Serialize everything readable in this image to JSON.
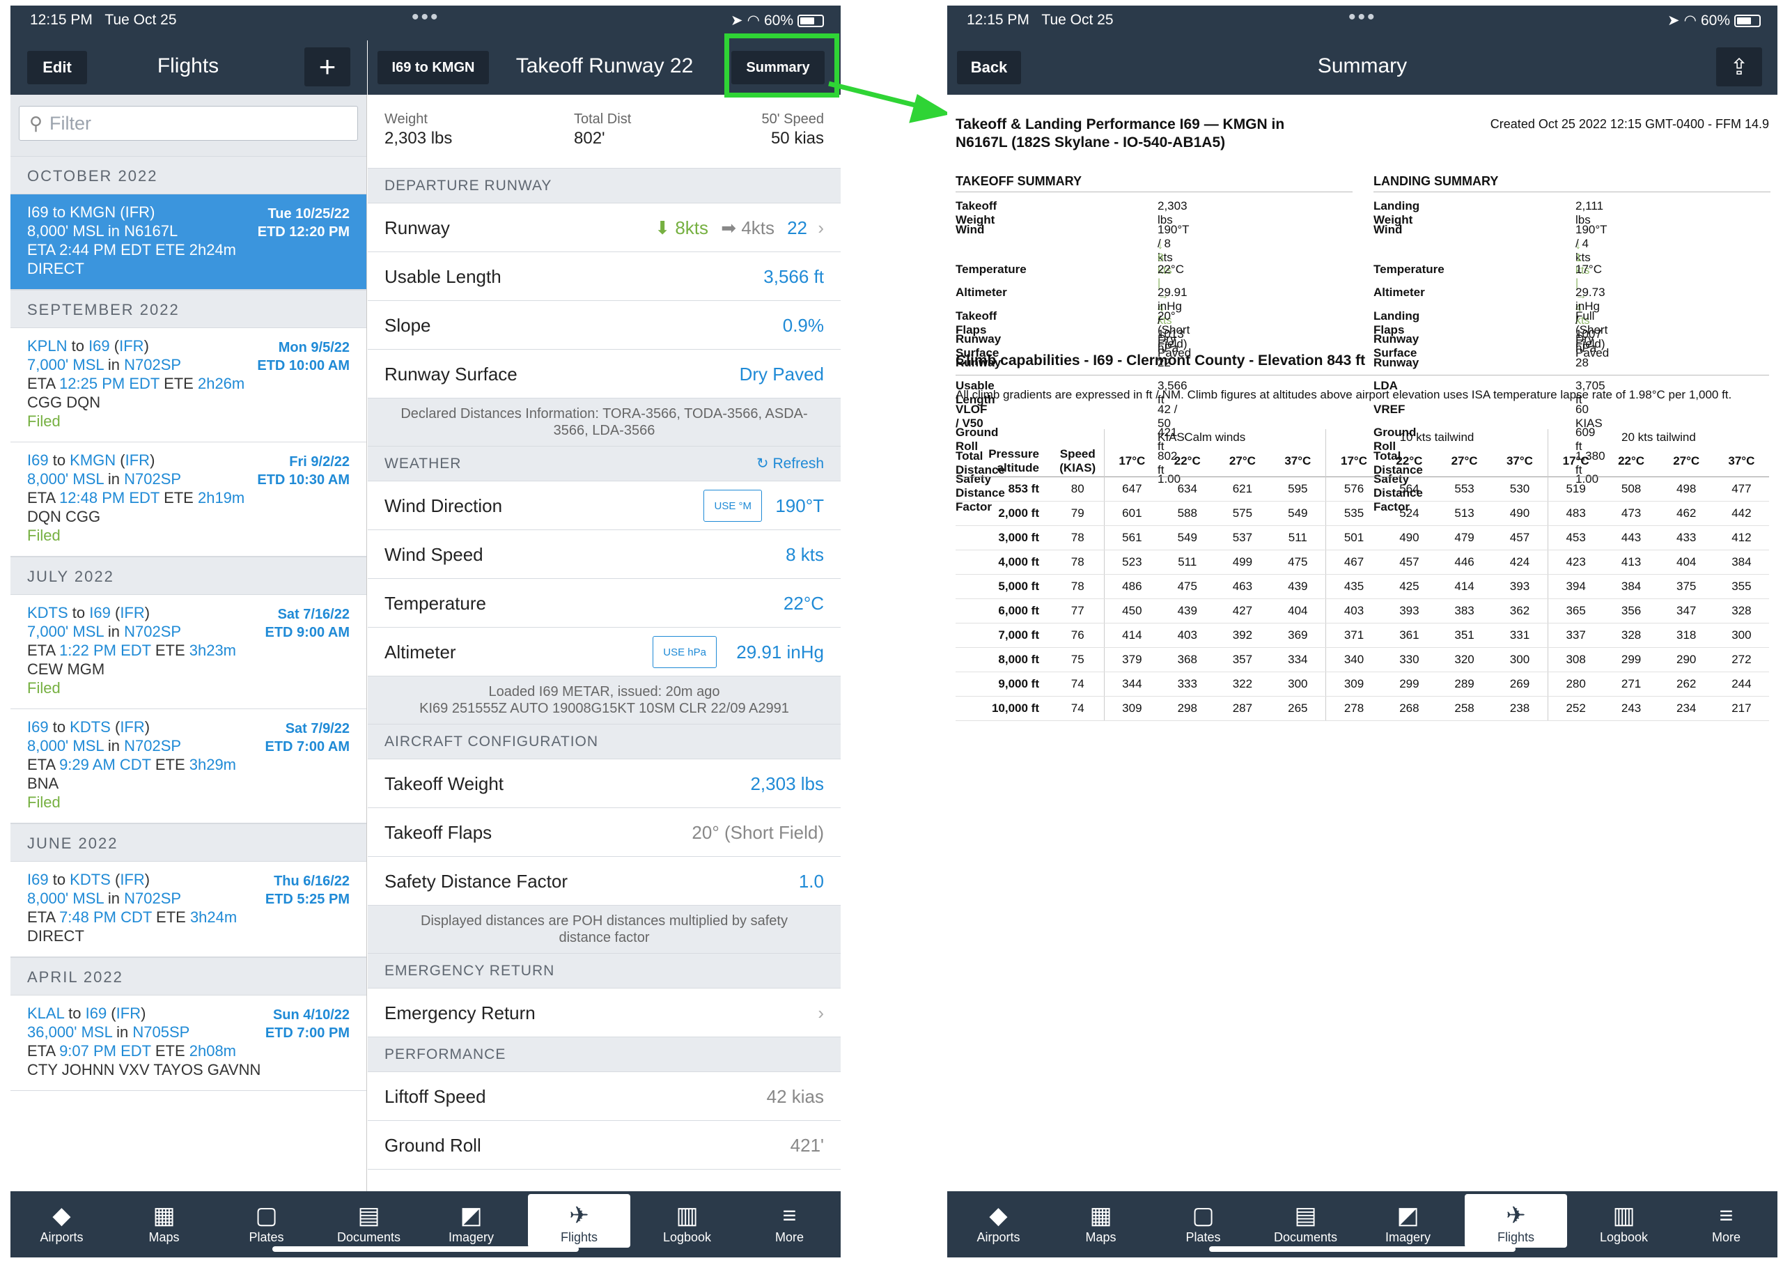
{
  "status": {
    "time": "12:15 PM",
    "date": "Tue Oct 25",
    "battery": "60%"
  },
  "flights_panel": {
    "edit_label": "Edit",
    "title": "Flights",
    "add_label": "+",
    "filter_placeholder": "Filter",
    "sections": [
      {
        "label": "OCTOBER 2022"
      },
      {
        "label": "SEPTEMBER 2022"
      },
      {
        "label": "JULY 2022"
      },
      {
        "label": "JUNE 2022"
      },
      {
        "label": "APRIL 2022"
      }
    ],
    "flights": [
      {
        "from": "I69",
        "to": "KMGN",
        "rule": "IFR",
        "alt": "8,000' MSL",
        "plane": "N6167L",
        "eta": "2:44 PM EDT",
        "ete": "2h24m",
        "route": "DIRECT",
        "status": "",
        "date": "Tue 10/25/22",
        "etd": "ETD 12:20 PM"
      },
      {
        "from": "KPLN",
        "to": "I69",
        "rule": "IFR",
        "alt": "7,000' MSL",
        "plane": "N702SP",
        "eta": "12:25 PM EDT",
        "ete": "2h26m",
        "route": "CGG DQN",
        "status": "Filed",
        "date": "Mon 9/5/22",
        "etd": "ETD 10:00 AM"
      },
      {
        "from": "I69",
        "to": "KMGN",
        "rule": "IFR",
        "alt": "8,000' MSL",
        "plane": "N702SP",
        "eta": "12:48 PM EDT",
        "ete": "2h19m",
        "route": "DQN CGG",
        "status": "Filed",
        "date": "Fri 9/2/22",
        "etd": "ETD 10:30 AM"
      },
      {
        "from": "KDTS",
        "to": "I69",
        "rule": "IFR",
        "alt": "7,000' MSL",
        "plane": "N702SP",
        "eta": "1:22 PM EDT",
        "ete": "3h23m",
        "route": "CEW MGM",
        "status": "Filed",
        "date": "Sat 7/16/22",
        "etd": "ETD 9:00 AM"
      },
      {
        "from": "I69",
        "to": "KDTS",
        "rule": "IFR",
        "alt": "8,000' MSL",
        "plane": "N702SP",
        "eta": "9:29 AM CDT",
        "ete": "3h29m",
        "route": "BNA",
        "status": "Filed",
        "date": "Sat 7/9/22",
        "etd": "ETD 7:00 AM"
      },
      {
        "from": "I69",
        "to": "KDTS",
        "rule": "IFR",
        "alt": "8,000' MSL",
        "plane": "N702SP",
        "eta": "7:48 PM CDT",
        "ete": "3h24m",
        "route": "DIRECT",
        "status": "",
        "date": "Thu 6/16/22",
        "etd": "ETD 5:25 PM"
      },
      {
        "from": "KLAL",
        "to": "I69",
        "rule": "IFR",
        "alt": "36,000' MSL",
        "plane": "N705SP",
        "eta": "9:07 PM EDT",
        "ete": "2h08m",
        "route": "CTY JOHNN VXV TAYOS GAVNN",
        "status": "",
        "date": "Sun 4/10/22",
        "etd": "ETD 7:00 PM"
      }
    ]
  },
  "takeoff_panel": {
    "back_label": "I69 to KMGN",
    "title": "Takeoff Runway 22",
    "summary_label": "Summary",
    "stats": [
      {
        "label": "Weight",
        "value": "2,303 lbs"
      },
      {
        "label": "Total Dist",
        "value": "802'"
      },
      {
        "label": "50' Speed",
        "value": "50 kias"
      }
    ],
    "departure_header": "DEPARTURE RUNWAY",
    "runway_label": "Runway",
    "runway_head": "8kts",
    "runway_cross": "4kts",
    "runway_value": "22",
    "usable_label": "Usable Length",
    "usable_value": "3,566 ft",
    "slope_label": "Slope",
    "slope_value": "0.9%",
    "surface_label": "Runway Surface",
    "surface_value": "Dry Paved",
    "declared_note": "Declared Distances Information: TORA-3566, TODA-3566, ASDA-3566, LDA-3566",
    "weather_header": "WEATHER",
    "refresh_label": "Refresh",
    "winddir_label": "Wind Direction",
    "use_m_label": "USE °M",
    "winddir_value": "190°T",
    "windspd_label": "Wind Speed",
    "windspd_value": "8 kts",
    "temp_label": "Temperature",
    "temp_value": "22°C",
    "altimeter_label": "Altimeter",
    "use_hpa_label": "USE hPa",
    "altimeter_value": "29.91 inHg",
    "metar_note_1": "Loaded I69 METAR, issued: 20m ago",
    "metar_note_2": "KI69 251555Z AUTO 19008G15KT 10SM CLR 22/09 A2991",
    "aircraft_header": "AIRCRAFT CONFIGURATION",
    "tow_label": "Takeoff Weight",
    "tow_value": "2,303 lbs",
    "flaps_label": "Takeoff Flaps",
    "flaps_value": "20° (Short Field)",
    "sdf_label": "Safety Distance Factor",
    "sdf_value": "1.0",
    "poh_note": "Displayed distances are POH distances multiplied by safety distance factor",
    "emergency_header": "EMERGENCY RETURN",
    "emergency_label": "Emergency Return",
    "performance_header": "PERFORMANCE",
    "liftoff_label": "Liftoff Speed",
    "liftoff_value": "42 kias",
    "groundroll_label": "Ground Roll",
    "groundroll_value": "421'"
  },
  "tabs": [
    "Airports",
    "Maps",
    "Plates",
    "Documents",
    "Imagery",
    "Flights",
    "Logbook",
    "More"
  ],
  "summary": {
    "back_label": "Back",
    "title": "Summary",
    "doc_title": "Takeoff & Landing Performance I69 — KMGN in N6167L (182S Skylane - IO-540-AB1A5)",
    "created": "Created Oct 25 2022 12:15 GMT-0400 - FFM 14.9",
    "takeoff_header": "TAKEOFF SUMMARY",
    "landing_header": "LANDING SUMMARY",
    "takeoff": [
      [
        "Takeoff Weight",
        "2,303 lbs"
      ],
      [
        "Wind",
        "190°T / 8 kts"
      ],
      [
        "Temperature",
        "22°C"
      ],
      [
        "Altimeter",
        "29.91 inHg / 1013 hPa"
      ],
      [
        "Takeoff Flaps",
        "20° (Short Field)"
      ],
      [
        "Runway Surface",
        "Dry Paved"
      ],
      [
        "Runway",
        "22"
      ],
      [
        "Usable Length",
        "3,566 ft"
      ],
      [
        "VLOF / V50",
        "42 / 50 KIAS"
      ],
      [
        "Ground Roll",
        "421 ft"
      ],
      [
        "Total Distance",
        "802 ft"
      ],
      [
        "Safety Distance Factor",
        "1.00"
      ]
    ],
    "takeoff_wind_sub": "↓ 8 kts | → 4 kts",
    "landing": [
      [
        "Landing Weight",
        "2,111 lbs"
      ],
      [
        "Wind",
        "190°T / 4 kts"
      ],
      [
        "Temperature",
        "17°C"
      ],
      [
        "Altimeter",
        "29.73 inHg / 1007 hPa"
      ],
      [
        "Landing Flaps",
        "Full (Short Field)"
      ],
      [
        "Runway Surface",
        "Dry Paved"
      ],
      [
        "Runway",
        "28"
      ],
      [
        "LDA",
        "3,705 ft"
      ],
      [
        "VREF",
        "60 KIAS"
      ],
      [
        "Ground Roll",
        "609 ft"
      ],
      [
        "Total Distance",
        "1,380 ft"
      ],
      [
        "Safety Distance Factor",
        "1.00"
      ]
    ],
    "landing_wind_sub": "↓ 1 kts | → 4 kts",
    "climb_title": "Climb capabilities - I69 - Clermont County - Elevation 843 ft",
    "climb_note": "All climb gradients are expressed in ft / NM. Climb figures at altitudes above airport elevation uses ISA temperature lapse rate of 1.98°C per 1,000 ft.",
    "groups": [
      "Calm winds",
      "10 kts tailwind",
      "20 kts tailwind"
    ],
    "col_alt": "Pressure altitude",
    "col_speed": "Speed (KIAS)",
    "temps": [
      "17°C",
      "22°C",
      "27°C",
      "37°C"
    ],
    "rows": [
      [
        "853 ft",
        "80",
        "647",
        "634",
        "621",
        "595",
        "576",
        "564",
        "553",
        "530",
        "519",
        "508",
        "498",
        "477"
      ],
      [
        "2,000 ft",
        "79",
        "601",
        "588",
        "575",
        "549",
        "535",
        "524",
        "513",
        "490",
        "483",
        "473",
        "462",
        "442"
      ],
      [
        "3,000 ft",
        "78",
        "561",
        "549",
        "537",
        "511",
        "501",
        "490",
        "479",
        "457",
        "453",
        "443",
        "433",
        "412"
      ],
      [
        "4,000 ft",
        "78",
        "523",
        "511",
        "499",
        "475",
        "467",
        "457",
        "446",
        "424",
        "423",
        "413",
        "404",
        "384"
      ],
      [
        "5,000 ft",
        "78",
        "486",
        "475",
        "463",
        "439",
        "435",
        "425",
        "414",
        "393",
        "394",
        "384",
        "375",
        "355"
      ],
      [
        "6,000 ft",
        "77",
        "450",
        "439",
        "427",
        "404",
        "403",
        "393",
        "383",
        "362",
        "365",
        "356",
        "347",
        "328"
      ],
      [
        "7,000 ft",
        "76",
        "414",
        "403",
        "392",
        "369",
        "371",
        "361",
        "351",
        "331",
        "337",
        "328",
        "318",
        "300"
      ],
      [
        "8,000 ft",
        "75",
        "379",
        "368",
        "357",
        "334",
        "340",
        "330",
        "320",
        "300",
        "308",
        "299",
        "290",
        "272"
      ],
      [
        "9,000 ft",
        "74",
        "344",
        "333",
        "322",
        "300",
        "309",
        "299",
        "289",
        "269",
        "280",
        "271",
        "262",
        "244"
      ],
      [
        "10,000 ft",
        "74",
        "309",
        "298",
        "287",
        "265",
        "278",
        "268",
        "258",
        "238",
        "252",
        "243",
        "234",
        "217"
      ]
    ]
  }
}
